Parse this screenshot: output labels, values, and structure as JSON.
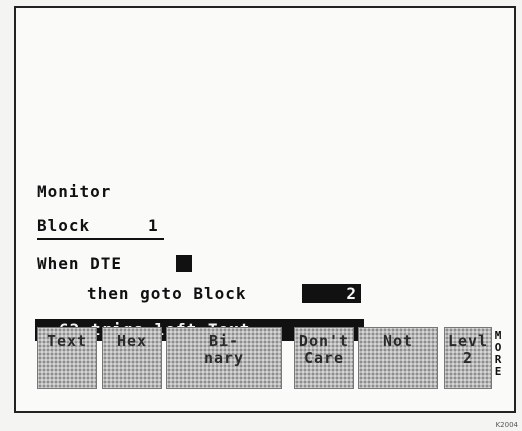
{
  "screen": {
    "monitor_label": "Monitor",
    "block_label": "Block",
    "block_number": "1",
    "when_label": "When DTE",
    "then_label": "then goto Block",
    "goto_block_value": "2",
    "status_line": "62 trigs left Text"
  },
  "softkeys": [
    {
      "line1": "Text",
      "line2": ""
    },
    {
      "line1": "Hex",
      "line2": ""
    },
    {
      "line1": "Bi-",
      "line2": "nary"
    },
    {
      "line1": "Don't",
      "line2": "Care"
    },
    {
      "line1": "Not",
      "line2": ""
    },
    {
      "line1": "Levl",
      "line2": "2"
    }
  ],
  "more_label": [
    "M",
    "O",
    "R",
    "E"
  ],
  "figure_code": "K2004"
}
